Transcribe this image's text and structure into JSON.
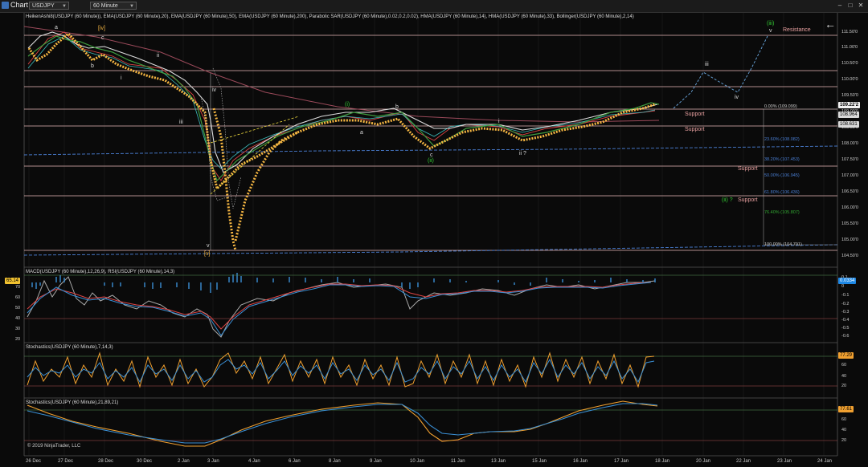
{
  "window": {
    "title": "Chart",
    "instrument": "USDJPY",
    "timeframe": "60 Minute"
  },
  "pane_labels": {
    "price": "HeikenAshi8(USDJPY (60 Minute)), EMA(USDJPY (60 Minute),20), EMA(USDJPY (60 Minute),50), EMA(USDJPY (60 Minute),200), Parabolic SAR(USDJPY (60 Minute),0.02,0.2,0.02), HMA(USDJPY (60 Minute),14), HMA(USDJPY (60 Minute),33), Bollinger(USDJPY (60 Minute),2,14)",
    "macd": "MACD(USDJPY (60 Minute),12,26,9), RSI(USDJPY (60 Minute),14,3)",
    "stoch1": "Stochastics(USDJPY (60 Minute),7,14,3)",
    "stoch2": "Stochastics(USDJPY (60 Minute),21,89,21)"
  },
  "price_axis": [
    "111.50'0",
    "111.00'0",
    "110.50'0",
    "110.00'0",
    "109.50'0",
    "109.00'0",
    "108.50'0",
    "108.00'0",
    "107.50'0",
    "107.00'0",
    "106.50'0",
    "106.00'0",
    "105.50'0",
    "105.00'0",
    "104.50'0"
  ],
  "price_badges": {
    "current": "109.22'2",
    "upper": "108.964",
    "lower": "108.631"
  },
  "macd_axis": [
    "0.1",
    "0",
    "-0.1",
    "-0.2",
    "-0.3",
    "-0.4",
    "-0.5",
    "-0.6",
    "-0.7"
  ],
  "rsi_axis": [
    "70",
    "60",
    "50",
    "40",
    "30",
    "20"
  ],
  "macd_badges": {
    "rsi": "65.14",
    "macd": "0.0334"
  },
  "stoch1_axis": [
    "80",
    "60",
    "40",
    "20"
  ],
  "stoch1_badge": "77.29",
  "stoch2_axis": [
    "80",
    "60",
    "40",
    "20"
  ],
  "stoch2_badge": "77.61",
  "x_axis": [
    "26 Dec",
    "27 Dec",
    "28 Dec",
    "30 Dec",
    "2 Jan",
    "3 Jan",
    "4 Jan",
    "6 Jan",
    "8 Jan",
    "9 Jan",
    "10 Jan",
    "11 Jan",
    "13 Jan",
    "15 Jan",
    "16 Jan",
    "17 Jan",
    "18 Jan",
    "20 Jan",
    "22 Jan",
    "23 Jan",
    "24 Jan"
  ],
  "wave_labels": {
    "a1": "a",
    "iv1": "[iv]",
    "c1": "c",
    "b1": "b",
    "i1": "i",
    "ii1": "ii",
    "iii1": "iii",
    "iv2": "iv",
    "v1": "v",
    "v2": "[v]",
    "i2": "(i)",
    "a2": "a",
    "b2": "b",
    "c2": "c",
    "ii2": "(ii)",
    "i3": "i",
    "ii3": "ii ?",
    "iii2": "iii",
    "iv3": "iv",
    "v3": "v",
    "iii3": "(iii)",
    "ii4": "(ii) ?"
  },
  "annotations": {
    "resistance": "Resistance",
    "support1": "Support",
    "support2": "Support",
    "support3": "Support",
    "support4": "Support"
  },
  "fib_labels": [
    "0.00% (109.099)",
    "23.60% (108.082)",
    "38.20% (107.453)",
    "50.00% (106.945)",
    "61.80% (106.436)",
    "76.40% (105.807)",
    "100.00% (104.791)"
  ],
  "copyright": "© 2019 NinjaTrader, LLC",
  "colors": {
    "background": "#0a0a0a",
    "sar": "#f5b642",
    "support_line": "#e8b9b9",
    "fib_line": "#4a7fd4",
    "macd_hist": "#3a8fd4",
    "stoch_k": "#f0a030",
    "stoch_d": "#3a8fd4",
    "wave_green": "#33cc33"
  }
}
